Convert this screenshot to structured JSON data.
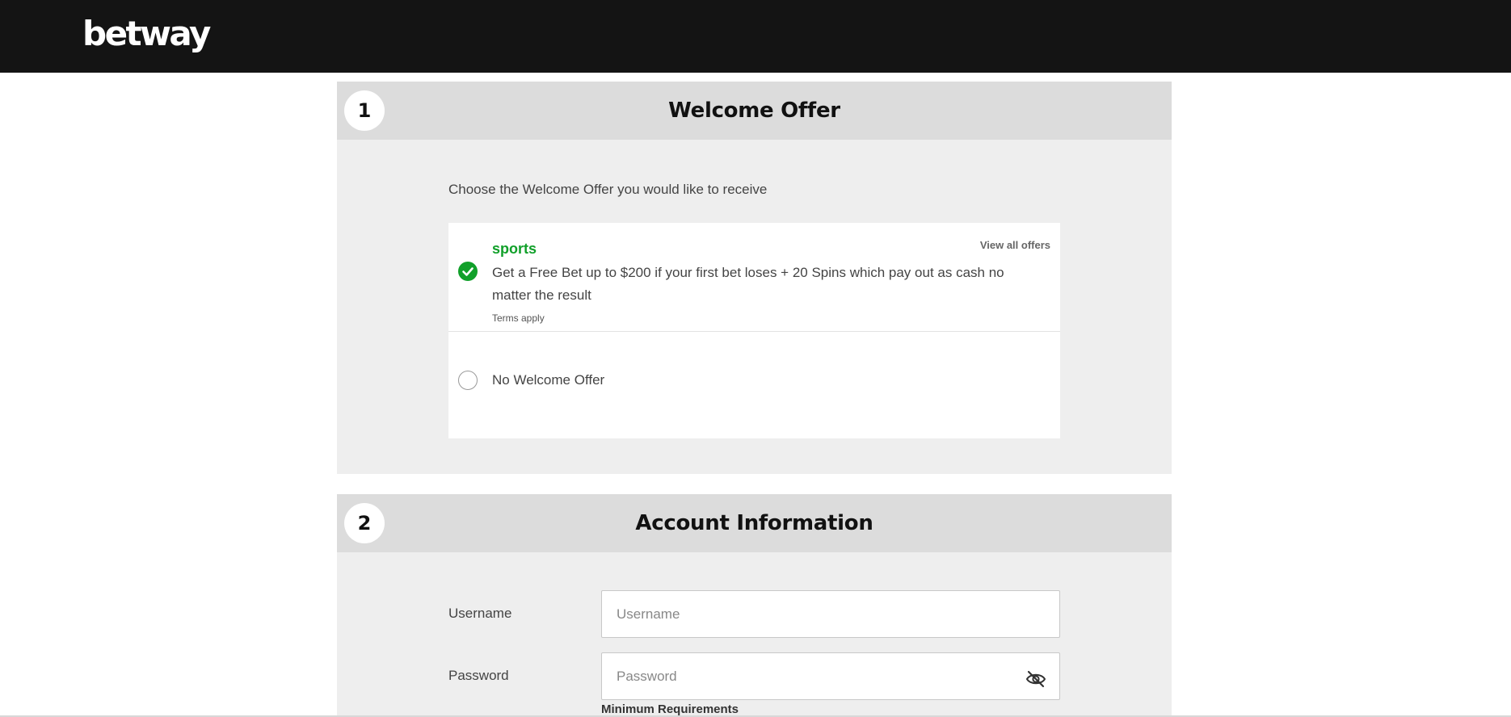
{
  "header": {
    "logo_text": "betway",
    "background": "#141414"
  },
  "welcome_section": {
    "step": "1",
    "title": "Welcome Offer",
    "intro": "Choose the Welcome Offer you would like to receive",
    "offers": [
      {
        "name": "sports",
        "view_all_label": "View all offers",
        "description": "Get a Free Bet up to $200 if your first bet loses + 20 Spins which pay out as cash no matter the result",
        "terms": "Terms apply",
        "selected": true
      },
      {
        "name": "No Welcome Offer",
        "selected": false
      }
    ]
  },
  "account_section": {
    "step": "2",
    "title": "Account Information",
    "username": {
      "label": "Username",
      "placeholder": "Username",
      "value": ""
    },
    "password": {
      "label": "Password",
      "placeholder": "Password",
      "value": "",
      "toggle_icon": "eye-slash-icon"
    },
    "min_requirements_label": "Minimum Requirements"
  },
  "colors": {
    "accent_green": "#11a02a",
    "section_bg": "#eeeeee",
    "section_header_bg": "#dcdcdc"
  }
}
